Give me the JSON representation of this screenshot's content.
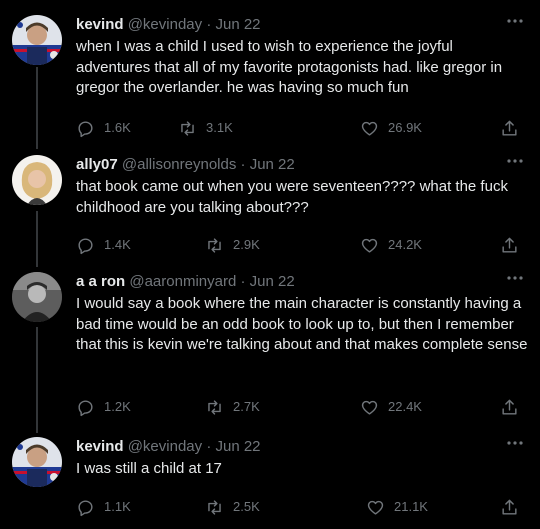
{
  "tweets": [
    {
      "name": "kevind",
      "handle": "@kevinday",
      "separator": "·",
      "date": "Jun 22",
      "text": "when I was a child I used to wish to experience the joyful adventures that all of my favorite protagonists had. like gregor in gregor the overlander. he was having so much fun",
      "replies": "1.6K",
      "retweets": "3.1K",
      "likes": "26.9K",
      "avatar_icon": "profile-photo-icon"
    },
    {
      "name": "ally07",
      "handle": "@allisonreynolds",
      "separator": "·",
      "date": "Jun 22",
      "text": "that book came out when you were seventeen???? what the fuck childhood are you talking about???",
      "replies": "1.4K",
      "retweets": "2.9K",
      "likes": "24.2K",
      "avatar_icon": "profile-photo-icon"
    },
    {
      "name": "a a ron",
      "handle": "@aaronminyard",
      "separator": "·",
      "date": "Jun 22",
      "text": "I would say a book where the main character is constantly having a bad time would be an odd book to look up to, but then I remember that this is kevin we're talking about and that makes complete sense",
      "replies": "1.2K",
      "retweets": "2.7K",
      "likes": "22.4K",
      "avatar_icon": "profile-photo-icon"
    },
    {
      "name": "kevind",
      "handle": "@kevinday",
      "separator": "·",
      "date": "Jun 22",
      "text": "I was still a child at 17",
      "replies": "1.1K",
      "retweets": "2.5K",
      "likes": "21.1K",
      "avatar_icon": "profile-photo-icon"
    }
  ],
  "colors": {
    "background": "#000000",
    "text": "#e7e9ea",
    "muted": "#71767b",
    "thread_line": "#333639"
  }
}
